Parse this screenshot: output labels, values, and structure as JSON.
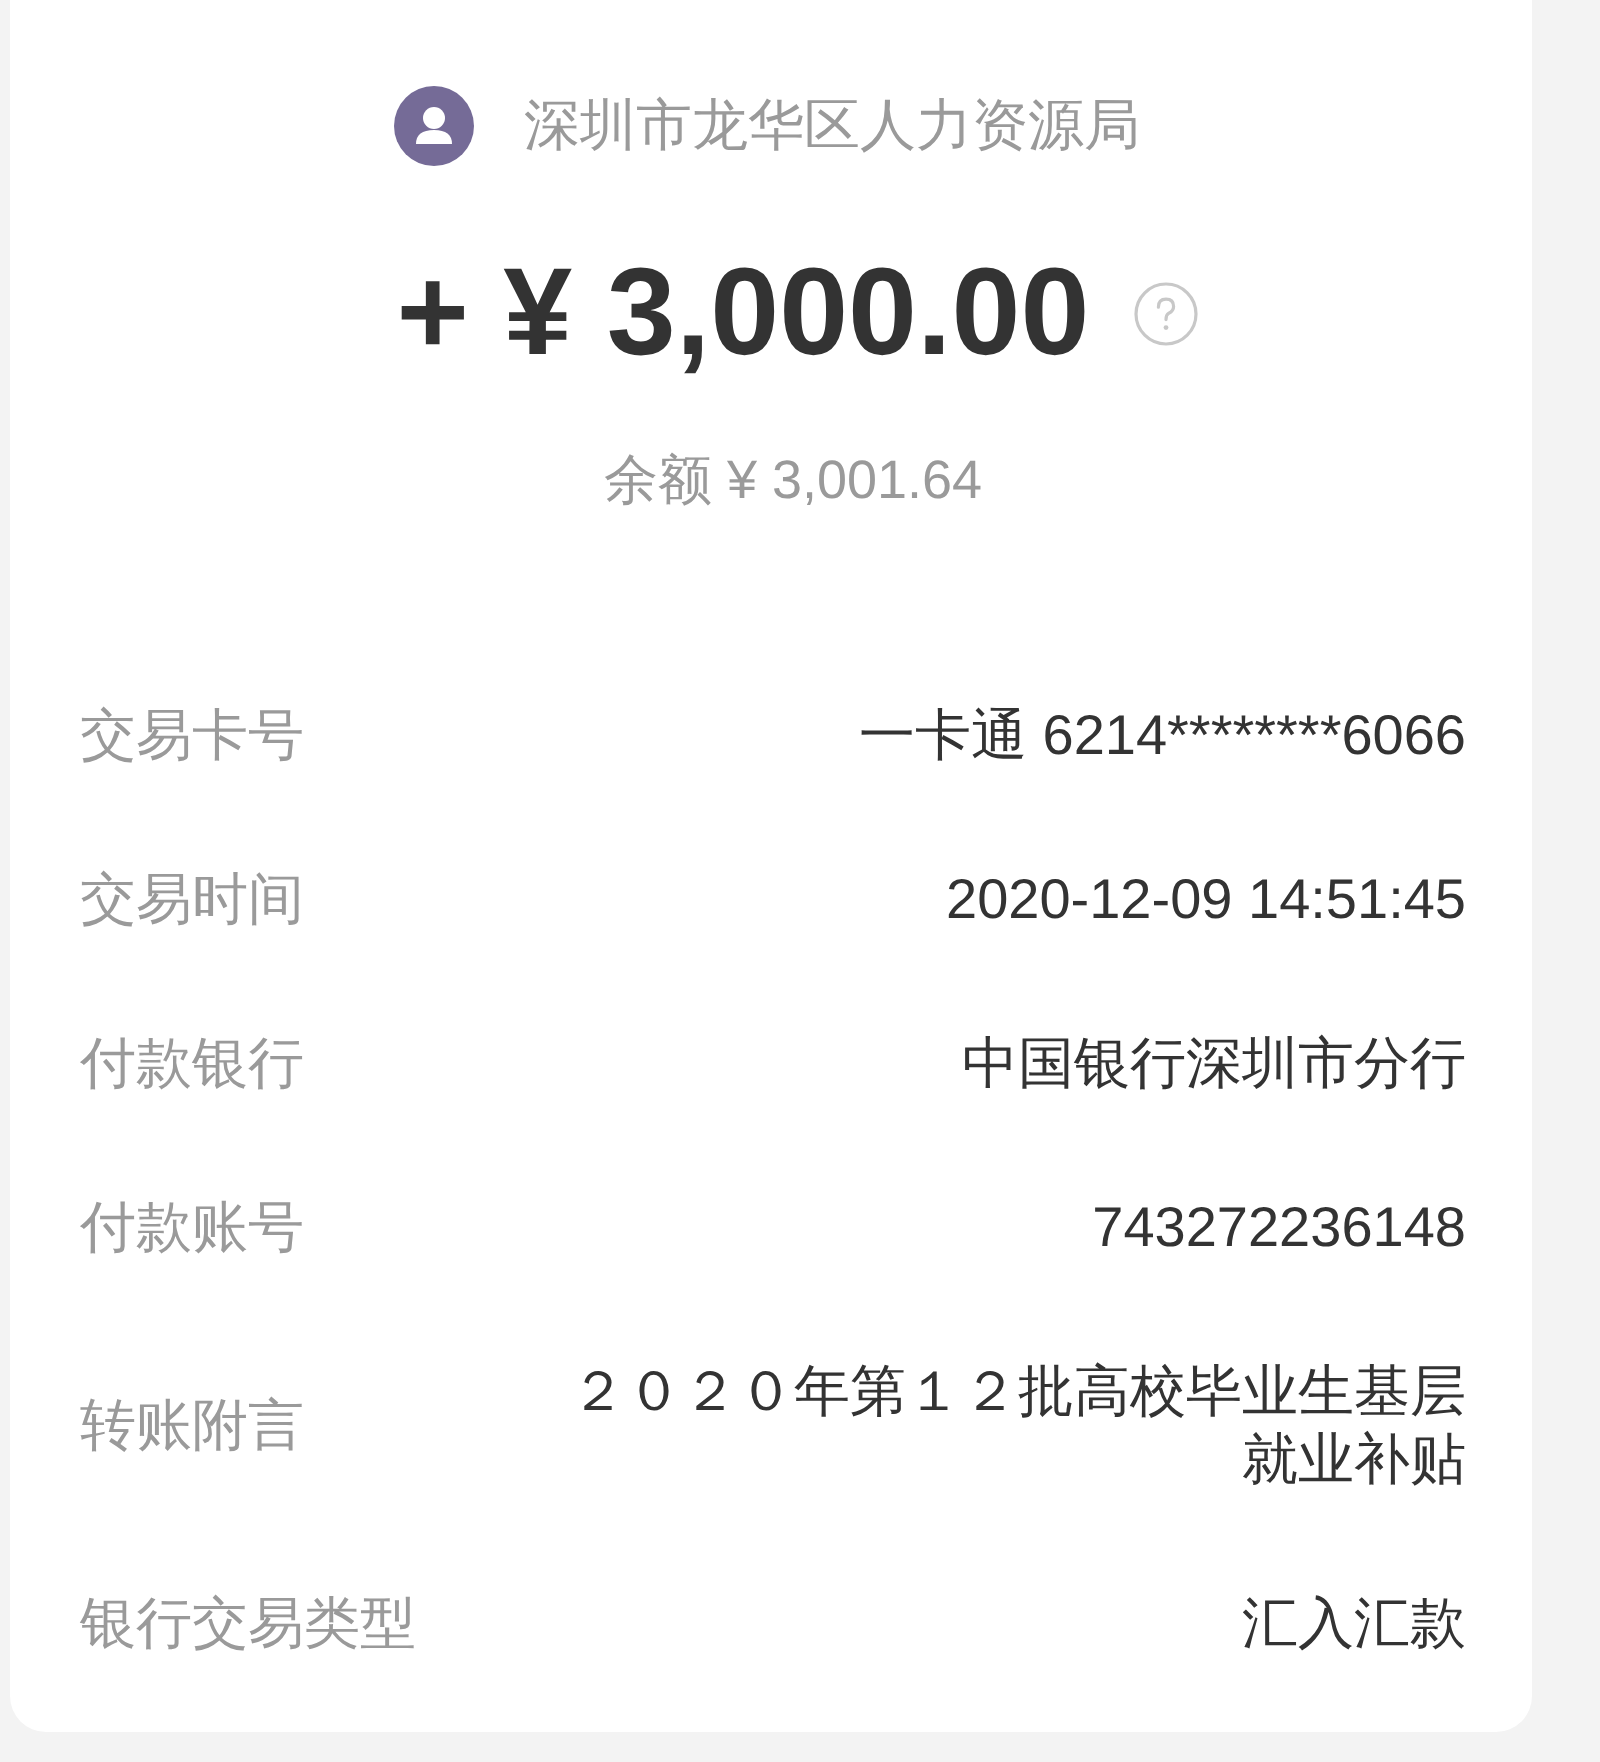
{
  "header": {
    "payer": "深圳市龙华区人力资源局",
    "amount": "+ ¥ 3,000.00",
    "balance": "余额 ¥ 3,001.64"
  },
  "details": [
    {
      "label": "交易卡号",
      "value": "一卡通 6214********6066"
    },
    {
      "label": "交易时间",
      "value": "2020-12-09 14:51:45"
    },
    {
      "label": "付款银行",
      "value": "中国银行深圳市分行"
    },
    {
      "label": "付款账号",
      "value": "743272236148"
    },
    {
      "label": "转账附言",
      "value": "２０２０年第１２批高校毕业生基层就业补贴"
    },
    {
      "label": "银行交易类型",
      "value": "汇入汇款"
    }
  ]
}
